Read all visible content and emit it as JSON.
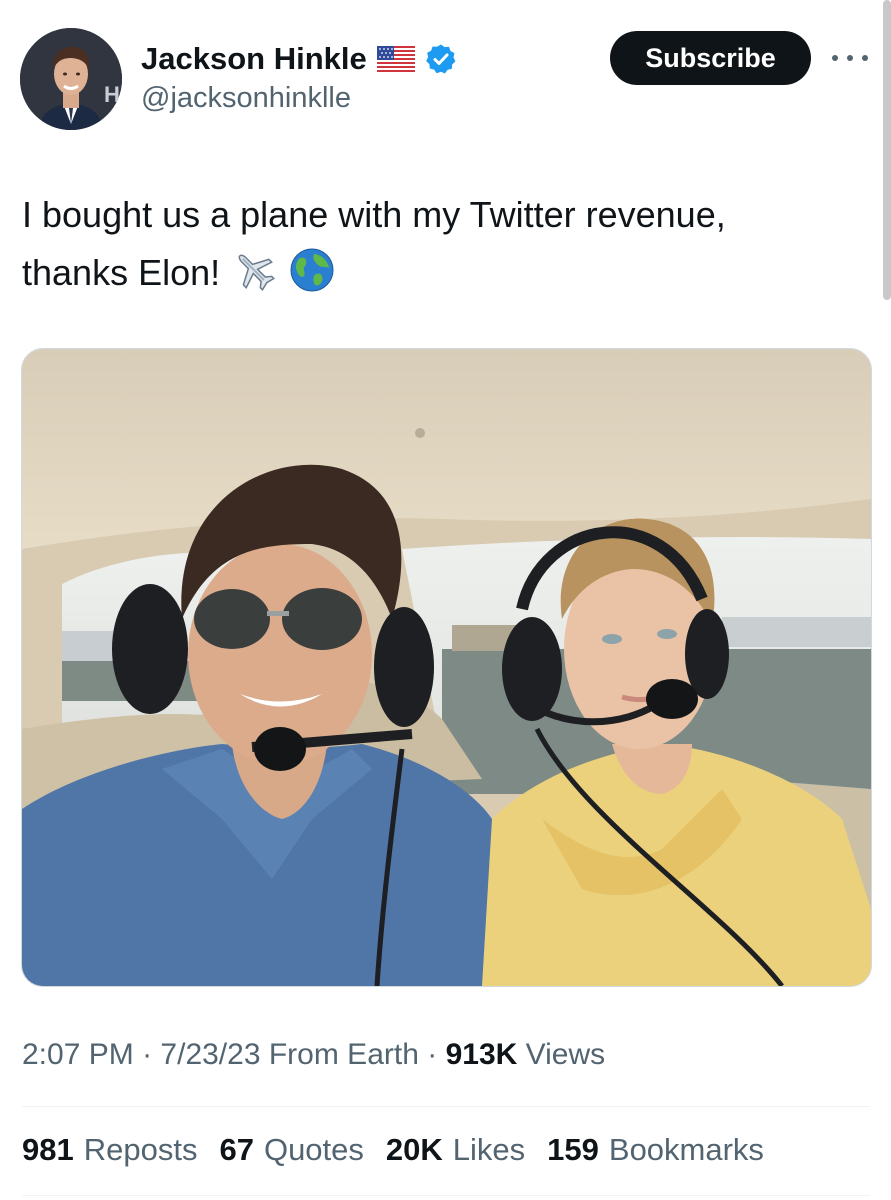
{
  "author": {
    "name": "Jackson Hinkle",
    "handle": "@jacksonhinklle",
    "avatar_logo_text": "HB",
    "flag_icon": "us-flag-icon",
    "verified_icon": "verified-badge-icon",
    "verified_color": "#1d9bf0"
  },
  "header": {
    "subscribe_label": "Subscribe",
    "more_icon": "more-options-icon"
  },
  "tweet": {
    "text_line1": "I bought us a plane with my Twitter revenue,",
    "text_line2": "thanks Elon!",
    "emojis": [
      "airplane-emoji",
      "globe-emoji"
    ]
  },
  "meta": {
    "time": "2:07 PM",
    "separator1": "·",
    "date": "7/23/23",
    "source": "From Earth",
    "separator2": "·",
    "views_count": "913K",
    "views_label": "Views"
  },
  "stats": [
    {
      "count": "981",
      "label": "Reposts"
    },
    {
      "count": "67",
      "label": "Quotes"
    },
    {
      "count": "20K",
      "label": "Likes"
    },
    {
      "count": "159",
      "label": "Bookmarks"
    }
  ]
}
